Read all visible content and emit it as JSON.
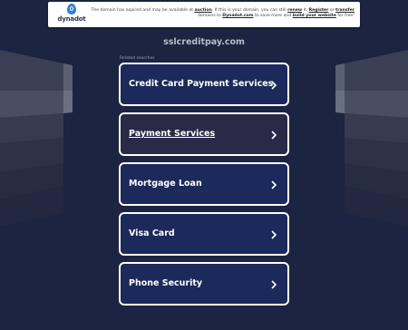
{
  "banner": {
    "logo_text": "dynadot",
    "notice_pre": "The domain has expired and may be available at ",
    "auction": "auction",
    "notice_mid1": ". If this is your domain, you can still ",
    "renew": "renew",
    "notice_mid2": " it. ",
    "register": "Register",
    "notice_or": " or ",
    "transfer": "transfer",
    "notice_mid3": " domains to ",
    "dynadot_link": "Dynadot.com",
    "notice_mid4": " to save more and ",
    "build": "build your website",
    "notice_end": " for free!"
  },
  "domain": "sslcreditpay.com",
  "related_label": "Related searches",
  "links": [
    {
      "label": "Credit Card Payment Services"
    },
    {
      "label": "Payment Services"
    },
    {
      "label": "Mortgage Loan"
    },
    {
      "label": "Visa Card"
    },
    {
      "label": "Phone Security"
    }
  ],
  "colors": {
    "background": "#1b2440",
    "button": "#1b2a5a",
    "button_hover": "#2a2a48",
    "border": "#ffffff"
  }
}
